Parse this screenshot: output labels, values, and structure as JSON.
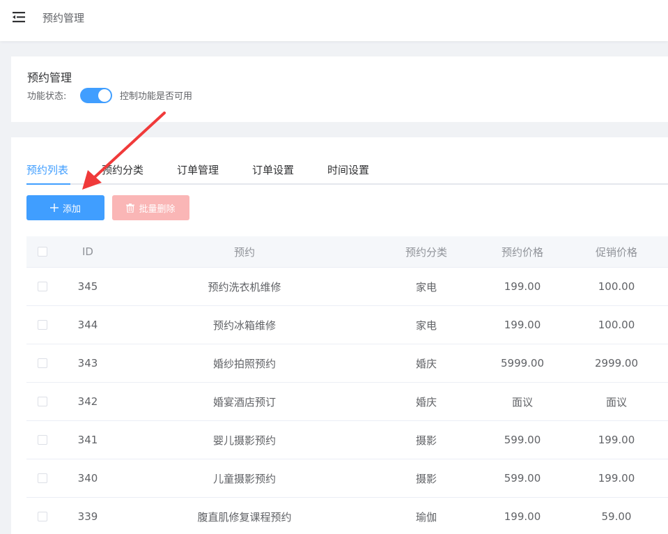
{
  "header": {
    "title": "预约管理"
  },
  "feature": {
    "title": "预约管理",
    "status_label": "功能状态:",
    "switch_on": true,
    "status_desc": "控制功能是否可用"
  },
  "tabs": [
    {
      "label": "预约列表",
      "active": true
    },
    {
      "label": "预约分类",
      "active": false
    },
    {
      "label": "订单管理",
      "active": false
    },
    {
      "label": "订单设置",
      "active": false
    },
    {
      "label": "时间设置",
      "active": false
    }
  ],
  "actions": {
    "add_label": "添加",
    "batch_delete_label": "批量删除"
  },
  "table": {
    "columns": [
      "ID",
      "预约",
      "预约分类",
      "预约价格",
      "促销价格"
    ],
    "rows": [
      {
        "id": "345",
        "name": "预约洗衣机维修",
        "category": "家电",
        "price": "199.00",
        "promo": "100.00"
      },
      {
        "id": "344",
        "name": "预约冰箱维修",
        "category": "家电",
        "price": "199.00",
        "promo": "100.00"
      },
      {
        "id": "343",
        "name": "婚纱拍照预约",
        "category": "婚庆",
        "price": "5999.00",
        "promo": "2999.00"
      },
      {
        "id": "342",
        "name": "婚宴酒店预订",
        "category": "婚庆",
        "price": "面议",
        "promo": "面议"
      },
      {
        "id": "341",
        "name": "婴儿摄影预约",
        "category": "摄影",
        "price": "599.00",
        "promo": "199.00"
      },
      {
        "id": "340",
        "name": "儿童摄影预约",
        "category": "摄影",
        "price": "599.00",
        "promo": "199.00"
      },
      {
        "id": "339",
        "name": "腹直肌修复课程预约",
        "category": "瑜伽",
        "price": "199.00",
        "promo": "59.00"
      }
    ]
  },
  "colors": {
    "primary": "#409eff",
    "danger_disabled": "#fab6b6",
    "annotation_arrow": "#f03a3a"
  }
}
